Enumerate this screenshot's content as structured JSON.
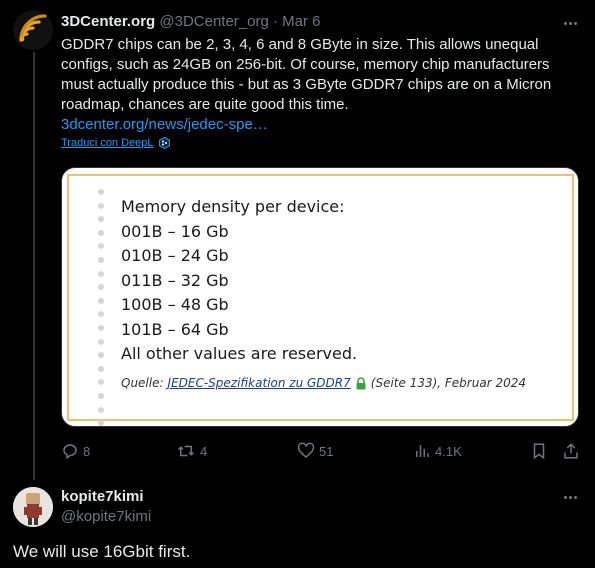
{
  "tweet1": {
    "author_name": "3DCenter.org",
    "author_handle": "@3DCenter_org",
    "separator": "·",
    "date": "Mar 6",
    "text": "GDDR7 chips can be 2, 3, 4, 6 and 8 GByte in size. This allows unequal configs, such as 24GB on 256-bit. Of course, memory chip manufacturers must actually produce this - but as 3 GByte GDDR7 chips are on a Micron roadmap, chances are quite good this time.",
    "link": "3dcenter.org/news/jedec-spe…",
    "translate_label": "Traduci con DeepL",
    "media": {
      "lines": [
        "Memory density per device:",
        "001B – 16 Gb",
        "010B – 24 Gb",
        "011B – 32 Gb",
        "100B – 48 Gb",
        "101B – 64 Gb",
        "All other values are reserved."
      ],
      "source_prefix": "Quelle:",
      "source_link": "JEDEC-Spezifikation zu GDDR7",
      "source_suffix": "(Seite 133), Februar 2024"
    },
    "actions": {
      "replies": "8",
      "reposts": "4",
      "likes": "51",
      "views": "4.1K"
    }
  },
  "tweet2": {
    "author_name": "kopite7kimi",
    "author_handle": "@kopite7kimi",
    "text": "We will use 16Gbit first."
  },
  "icons": {
    "more": "more-horizontal-icon",
    "reply": "reply-icon",
    "repost": "repost-icon",
    "like": "heart-icon",
    "views": "views-bar-chart-icon",
    "bookmark": "bookmark-icon",
    "share": "share-icon",
    "deepl": "deepl-logo-icon",
    "lock": "lock-icon"
  },
  "colors": {
    "background": "#000000",
    "text": "#e7e9ea",
    "muted": "#71767b",
    "link": "#1d9bf0",
    "media_border": "#e8c372"
  }
}
